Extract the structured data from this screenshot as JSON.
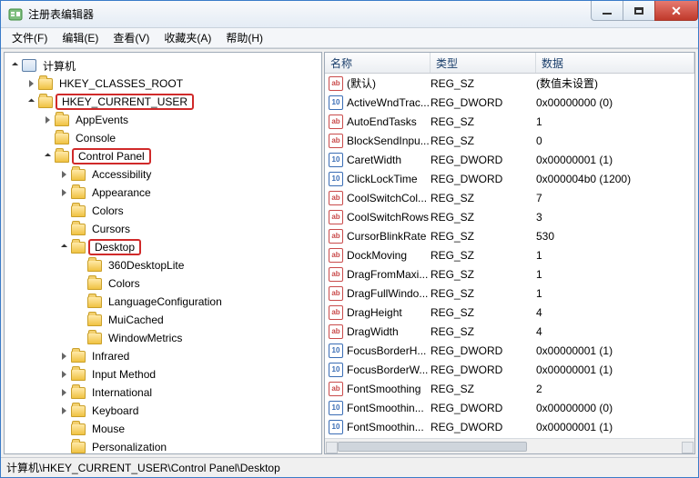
{
  "window": {
    "title": "注册表编辑器"
  },
  "menu": {
    "file": "文件(F)",
    "edit": "编辑(E)",
    "view": "查看(V)",
    "favorites": "收藏夹(A)",
    "help": "帮助(H)"
  },
  "tree": {
    "root_label": "计算机",
    "items": [
      {
        "depth": 0,
        "label": "计算机",
        "expander": "open",
        "icon": "computer",
        "highlight": false
      },
      {
        "depth": 1,
        "label": "HKEY_CLASSES_ROOT",
        "expander": "closed",
        "icon": "folder",
        "highlight": false
      },
      {
        "depth": 1,
        "label": "HKEY_CURRENT_USER",
        "expander": "open",
        "icon": "folder",
        "highlight": true
      },
      {
        "depth": 2,
        "label": "AppEvents",
        "expander": "closed",
        "icon": "folder",
        "highlight": false
      },
      {
        "depth": 2,
        "label": "Console",
        "expander": "blank",
        "icon": "folder",
        "highlight": false
      },
      {
        "depth": 2,
        "label": "Control Panel",
        "expander": "open",
        "icon": "folder",
        "highlight": true
      },
      {
        "depth": 3,
        "label": "Accessibility",
        "expander": "closed",
        "icon": "folder",
        "highlight": false
      },
      {
        "depth": 3,
        "label": "Appearance",
        "expander": "closed",
        "icon": "folder",
        "highlight": false
      },
      {
        "depth": 3,
        "label": "Colors",
        "expander": "blank",
        "icon": "folder",
        "highlight": false
      },
      {
        "depth": 3,
        "label": "Cursors",
        "expander": "blank",
        "icon": "folder",
        "highlight": false
      },
      {
        "depth": 3,
        "label": "Desktop",
        "expander": "open",
        "icon": "folder",
        "highlight": true
      },
      {
        "depth": 4,
        "label": "360DesktopLite",
        "expander": "blank",
        "icon": "folder",
        "highlight": false
      },
      {
        "depth": 4,
        "label": "Colors",
        "expander": "blank",
        "icon": "folder",
        "highlight": false
      },
      {
        "depth": 4,
        "label": "LanguageConfiguration",
        "expander": "blank",
        "icon": "folder",
        "highlight": false
      },
      {
        "depth": 4,
        "label": "MuiCached",
        "expander": "blank",
        "icon": "folder",
        "highlight": false
      },
      {
        "depth": 4,
        "label": "WindowMetrics",
        "expander": "blank",
        "icon": "folder",
        "highlight": false
      },
      {
        "depth": 3,
        "label": "Infrared",
        "expander": "closed",
        "icon": "folder",
        "highlight": false
      },
      {
        "depth": 3,
        "label": "Input Method",
        "expander": "closed",
        "icon": "folder",
        "highlight": false
      },
      {
        "depth": 3,
        "label": "International",
        "expander": "closed",
        "icon": "folder",
        "highlight": false
      },
      {
        "depth": 3,
        "label": "Keyboard",
        "expander": "closed",
        "icon": "folder",
        "highlight": false
      },
      {
        "depth": 3,
        "label": "Mouse",
        "expander": "blank",
        "icon": "folder",
        "highlight": false
      },
      {
        "depth": 3,
        "label": "Personalization",
        "expander": "blank",
        "icon": "folder",
        "highlight": false
      }
    ]
  },
  "list": {
    "headers": {
      "name": "名称",
      "type": "类型",
      "data": "数据"
    },
    "rows": [
      {
        "icon": "sz",
        "name": "(默认)",
        "type": "REG_SZ",
        "data": "(数值未设置)"
      },
      {
        "icon": "dw",
        "name": "ActiveWndTrac...",
        "type": "REG_DWORD",
        "data": "0x00000000 (0)"
      },
      {
        "icon": "sz",
        "name": "AutoEndTasks",
        "type": "REG_SZ",
        "data": "1"
      },
      {
        "icon": "sz",
        "name": "BlockSendInpu...",
        "type": "REG_SZ",
        "data": "0"
      },
      {
        "icon": "dw",
        "name": "CaretWidth",
        "type": "REG_DWORD",
        "data": "0x00000001 (1)"
      },
      {
        "icon": "dw",
        "name": "ClickLockTime",
        "type": "REG_DWORD",
        "data": "0x000004b0 (1200)"
      },
      {
        "icon": "sz",
        "name": "CoolSwitchCol...",
        "type": "REG_SZ",
        "data": "7"
      },
      {
        "icon": "sz",
        "name": "CoolSwitchRows",
        "type": "REG_SZ",
        "data": "3"
      },
      {
        "icon": "sz",
        "name": "CursorBlinkRate",
        "type": "REG_SZ",
        "data": "530"
      },
      {
        "icon": "sz",
        "name": "DockMoving",
        "type": "REG_SZ",
        "data": "1"
      },
      {
        "icon": "sz",
        "name": "DragFromMaxi...",
        "type": "REG_SZ",
        "data": "1"
      },
      {
        "icon": "sz",
        "name": "DragFullWindo...",
        "type": "REG_SZ",
        "data": "1"
      },
      {
        "icon": "sz",
        "name": "DragHeight",
        "type": "REG_SZ",
        "data": "4"
      },
      {
        "icon": "sz",
        "name": "DragWidth",
        "type": "REG_SZ",
        "data": "4"
      },
      {
        "icon": "dw",
        "name": "FocusBorderH...",
        "type": "REG_DWORD",
        "data": "0x00000001 (1)"
      },
      {
        "icon": "dw",
        "name": "FocusBorderW...",
        "type": "REG_DWORD",
        "data": "0x00000001 (1)"
      },
      {
        "icon": "sz",
        "name": "FontSmoothing",
        "type": "REG_SZ",
        "data": "2"
      },
      {
        "icon": "dw",
        "name": "FontSmoothin...",
        "type": "REG_DWORD",
        "data": "0x00000000 (0)"
      },
      {
        "icon": "dw",
        "name": "FontSmoothin...",
        "type": "REG_DWORD",
        "data": "0x00000001 (1)"
      }
    ]
  },
  "statusbar": {
    "path": "计算机\\HKEY_CURRENT_USER\\Control Panel\\Desktop"
  },
  "icons": {
    "sz_text": "ab",
    "dw_text": "011\n110"
  }
}
